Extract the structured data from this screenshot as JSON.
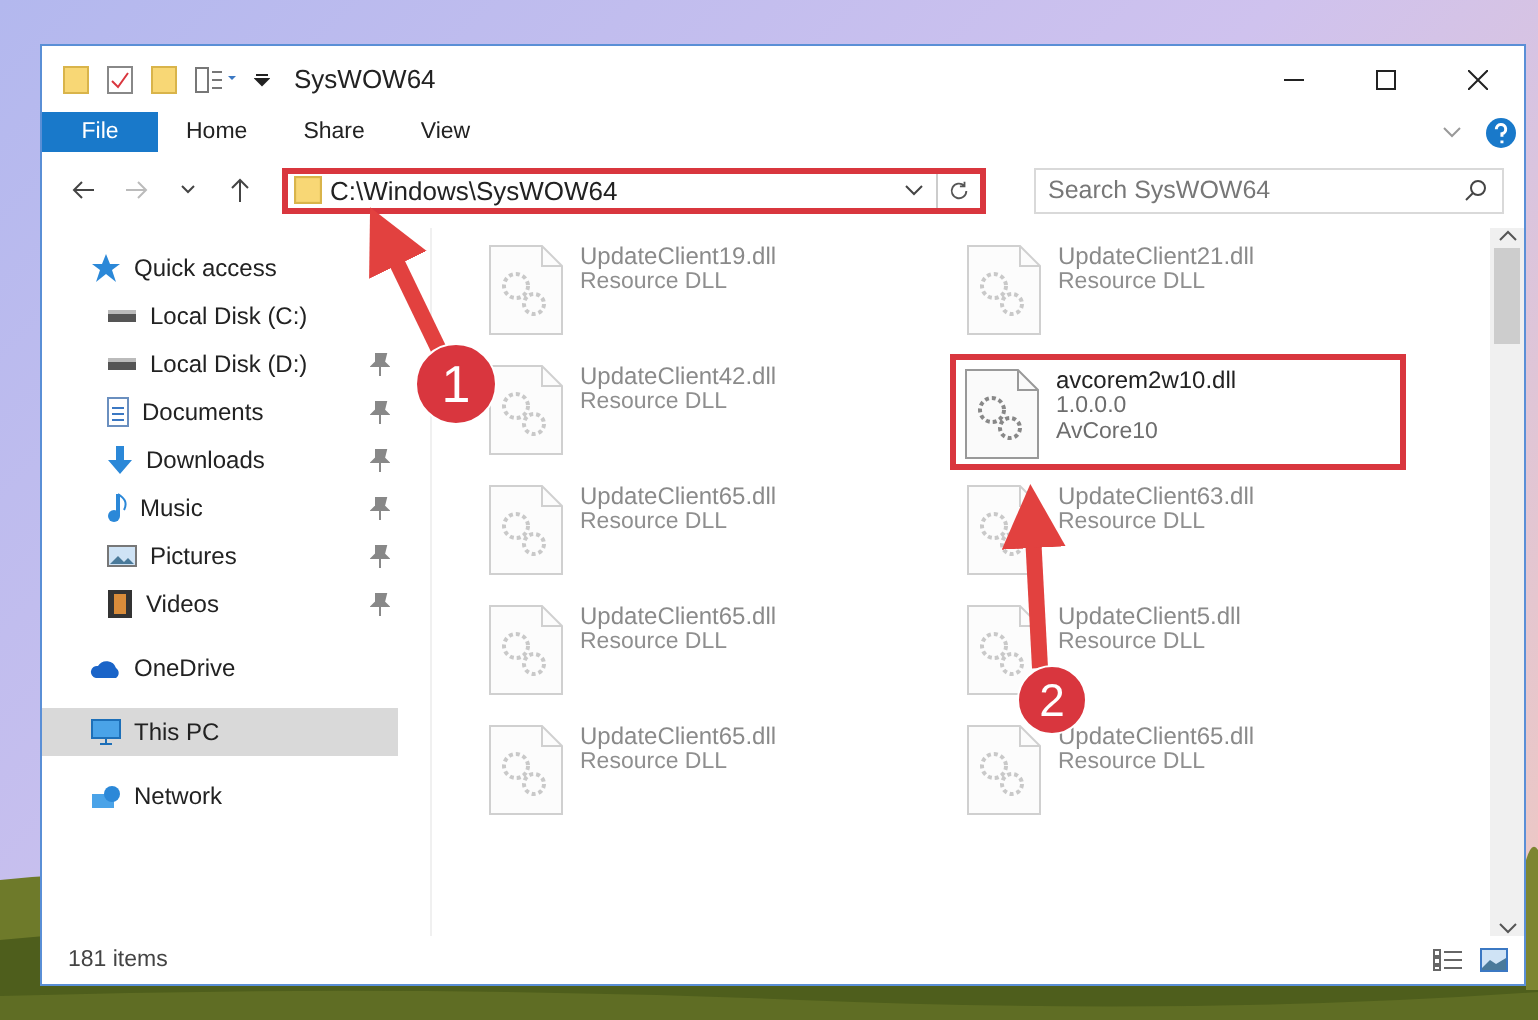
{
  "window": {
    "title": "SysWOW64"
  },
  "ribbon_tabs": [
    {
      "label": "File",
      "selected": true
    },
    {
      "label": "Home",
      "selected": false
    },
    {
      "label": "Share",
      "selected": false
    },
    {
      "label": "View",
      "selected": false
    }
  ],
  "address": {
    "path": "C:\\Windows\\SysWOW64",
    "highlighted": true
  },
  "search": {
    "placeholder": "Search SysWOW64"
  },
  "sidebar": {
    "items": [
      {
        "label": "Quick access",
        "kind": "star",
        "pinned": false,
        "selected": false,
        "children": [
          {
            "label": "Local Disk (C:)",
            "kind": "disk",
            "pinned": false,
            "selected": false
          },
          {
            "label": "Local Disk (D:)",
            "kind": "disk",
            "pinned": true,
            "selected": false
          },
          {
            "label": "Documents",
            "kind": "doc",
            "pinned": true,
            "selected": false
          },
          {
            "label": "Downloads",
            "kind": "download",
            "pinned": true,
            "selected": false
          },
          {
            "label": "Music",
            "kind": "music",
            "pinned": true,
            "selected": false
          },
          {
            "label": "Pictures",
            "kind": "pictures",
            "pinned": true,
            "selected": false
          },
          {
            "label": "Videos",
            "kind": "videos",
            "pinned": true,
            "selected": false
          }
        ]
      },
      {
        "label": "OneDrive",
        "kind": "cloud",
        "pinned": false,
        "selected": false
      },
      {
        "label": "This PC",
        "kind": "pc",
        "pinned": false,
        "selected": true
      },
      {
        "label": "Network",
        "kind": "network",
        "pinned": false,
        "selected": false
      }
    ]
  },
  "files": [
    {
      "name": "UpdateClient19.dll",
      "line_2": "Resource DLL",
      "faded": true,
      "highlighted": false
    },
    {
      "name": "UpdateClient21.dll",
      "line_2": "Resource DLL",
      "faded": true,
      "highlighted": false
    },
    {
      "name": "UpdateClient42.dll",
      "line_2": "Resource DLL",
      "faded": true,
      "highlighted": false
    },
    {
      "name": "avcorem2w10.dll",
      "line_2": "1.0.0.0",
      "line_3": "AvCore10",
      "faded": false,
      "highlighted": true
    },
    {
      "name": "UpdateClient65.dll",
      "line_2": "Resource DLL",
      "faded": true,
      "highlighted": false
    },
    {
      "name": "UpdateClient63.dll",
      "line_2": "Resource DLL",
      "faded": true,
      "highlighted": false
    },
    {
      "name": "UpdateClient65.dll",
      "line_2": "Resource DLL",
      "faded": true,
      "highlighted": false
    },
    {
      "name": "UpdateClient5.dll",
      "line_2": "Resource DLL",
      "faded": true,
      "highlighted": false
    },
    {
      "name": "UpdateClient65.dll",
      "line_2": "Resource DLL",
      "faded": true,
      "highlighted": false
    },
    {
      "name": "UpdateClient65.dll",
      "line_2": "Resource DLL",
      "faded": true,
      "highlighted": false
    }
  ],
  "status_bar": {
    "count": "181 items"
  },
  "annotations": [
    {
      "number": "1"
    },
    {
      "number": "2"
    }
  ]
}
